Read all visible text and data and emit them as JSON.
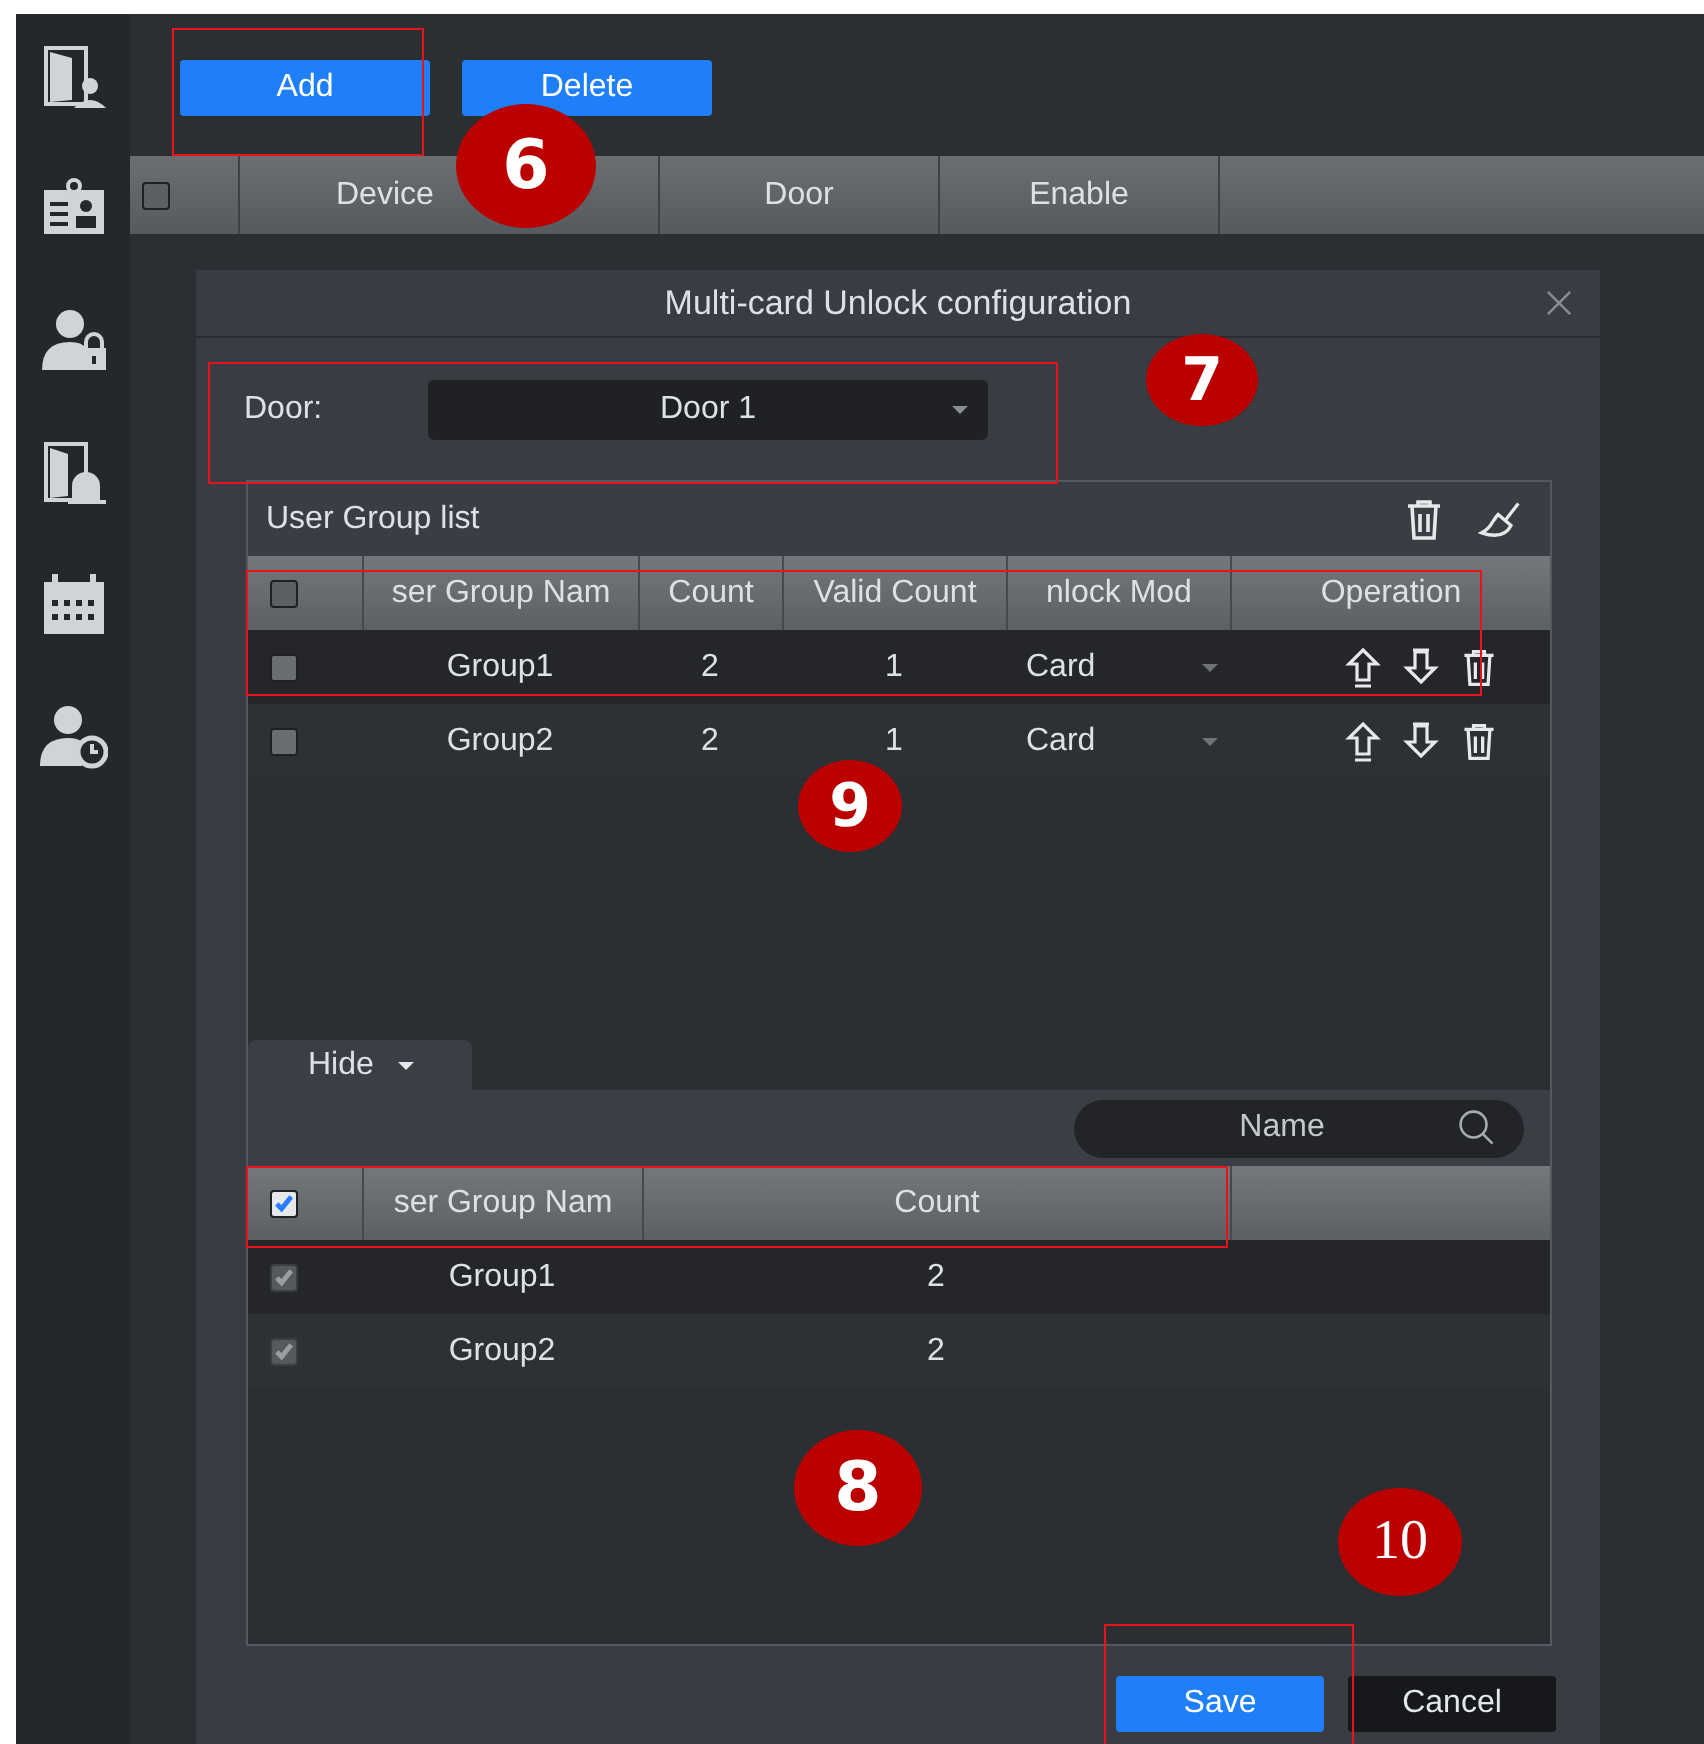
{
  "toolbar": {
    "buttons": [
      "Add",
      "Delete"
    ]
  },
  "device_table": {
    "select_all": {
      "checked": false
    },
    "columns": [
      "Device",
      "Door",
      "Enable"
    ]
  },
  "dialog": {
    "title": "Multi-card Unlock configuration",
    "door": {
      "label": "Door:",
      "value": "Door 1"
    },
    "user_group_list": {
      "title": "User Group list",
      "select_all": {
        "checked": false
      },
      "columns": [
        "ser Group Nam",
        "Count",
        "Valid Count",
        "nlock Mod",
        "Operation"
      ],
      "rows": [
        {
          "checked": false,
          "name": "Group1",
          "count": "2",
          "valid_count": "1",
          "unlock_mode": "Card"
        },
        {
          "checked": false,
          "name": "Group2",
          "count": "2",
          "valid_count": "1",
          "unlock_mode": "Card"
        }
      ]
    },
    "tab": {
      "label": "Hide"
    },
    "search": {
      "placeholder": "Name"
    },
    "members": {
      "select_all": {
        "checked": true
      },
      "columns": [
        "ser Group Nam",
        "Count"
      ],
      "rows": [
        {
          "checked": true,
          "disabled": true,
          "name": "Group1",
          "count": "2"
        },
        {
          "checked": true,
          "disabled": true,
          "name": "Group2",
          "count": "2"
        }
      ]
    },
    "buttons": [
      {
        "label": "Save",
        "kind": "primary"
      },
      {
        "label": "Cancel",
        "kind": "secondary"
      }
    ]
  },
  "callouts": [
    "6",
    "7",
    "9",
    "8",
    "10"
  ]
}
